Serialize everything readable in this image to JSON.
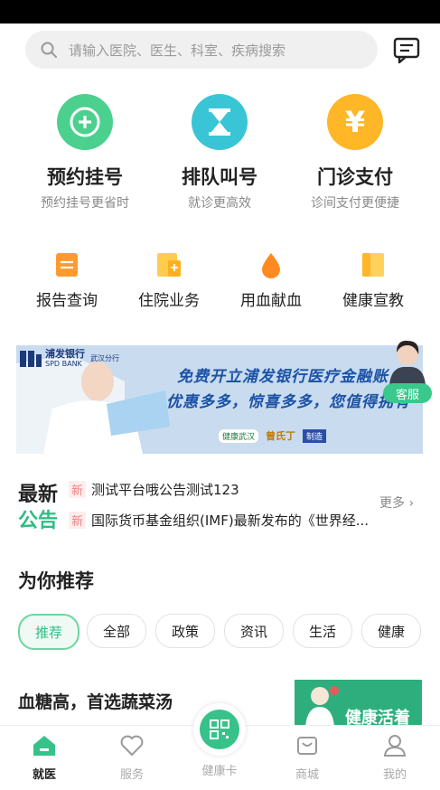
{
  "search": {
    "placeholder": "请输入医院、医生、科室、疾病搜索"
  },
  "main_services": [
    {
      "title": "预约挂号",
      "subtitle": "预约挂号更省时",
      "icon": "plus-icon",
      "color": "#4cd08e"
    },
    {
      "title": "排队叫号",
      "subtitle": "就诊更高效",
      "icon": "hourglass-icon",
      "color": "#39c5d6"
    },
    {
      "title": "门诊支付",
      "subtitle": "诊间支付更便捷",
      "icon": "yen-icon",
      "color": "#ffb627"
    }
  ],
  "sub_services": [
    {
      "label": "报告查询",
      "icon": "report-icon"
    },
    {
      "label": "住院业务",
      "icon": "hospital-icon"
    },
    {
      "label": "用血献血",
      "icon": "blood-drop-icon"
    },
    {
      "label": "健康宣教",
      "icon": "book-icon"
    }
  ],
  "banner": {
    "bank_name": "浦发银行",
    "bank_en": "SPD BANK",
    "branch": "武汉分行",
    "line1": "免费开立浦发银行医疗金融账",
    "line2": "优惠多多，惊喜多多，您值得拥有",
    "logos": [
      "健康武汉",
      "曾氏丁",
      "制造"
    ]
  },
  "customer_service": {
    "label": "客服"
  },
  "news": {
    "title_1": "最新",
    "title_2": "公告",
    "badge": "新",
    "items": [
      "测试平台哦公告测试123",
      "国际货币基金组织(IMF)最新发布的《世界经..."
    ],
    "more": "更多"
  },
  "recommend": {
    "title": "为你推荐",
    "chips": [
      "推荐",
      "全部",
      "政策",
      "资讯",
      "生活",
      "健康"
    ],
    "active_chip": "推荐"
  },
  "article": {
    "title": "血糖高，首选蔬菜汤",
    "thumb_text": "健康活着"
  },
  "tabbar": {
    "items": [
      "就医",
      "服务",
      "健康卡",
      "商城",
      "我的"
    ],
    "active": "就医"
  },
  "colors": {
    "accent": "#37c28a",
    "news_title_green": "#2fbd84"
  }
}
